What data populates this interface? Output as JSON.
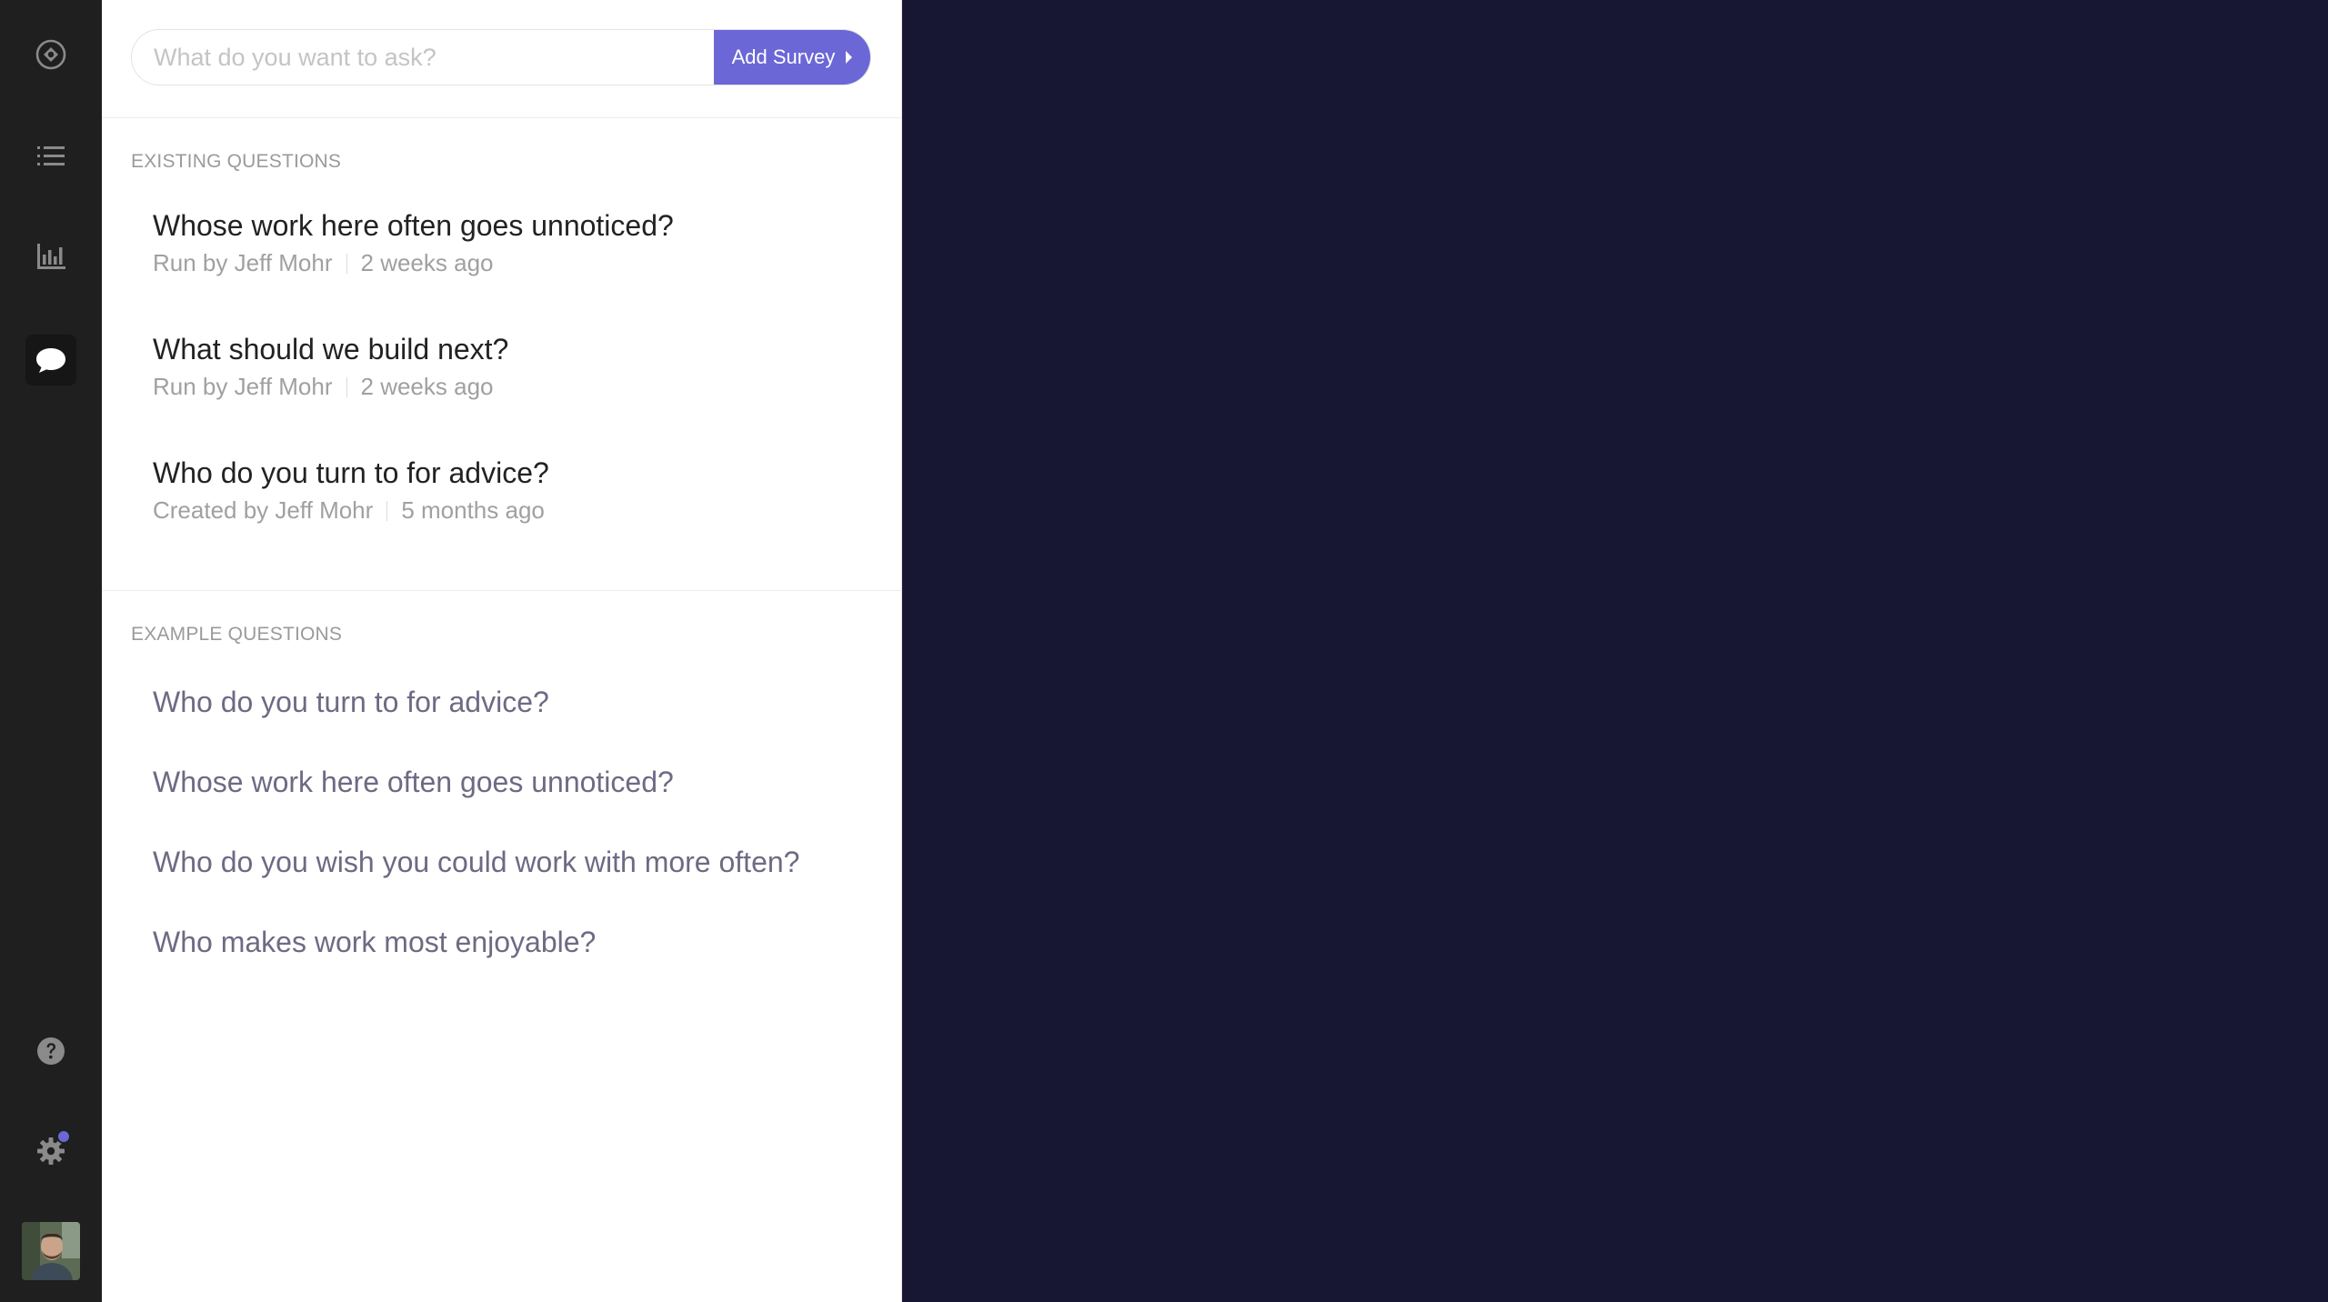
{
  "rail": {
    "items": [
      {
        "icon": "compass-icon"
      },
      {
        "icon": "numbered-list-icon"
      },
      {
        "icon": "bar-chart-icon"
      },
      {
        "icon": "chat-bubble-icon",
        "active": true
      },
      {
        "icon": "help-icon"
      },
      {
        "icon": "gear-icon",
        "badge": true
      }
    ],
    "accent": "#6b67d6"
  },
  "ask": {
    "placeholder": "What do you want to ask?",
    "button_label": "Add Survey"
  },
  "existing": {
    "label": "EXISTING QUESTIONS",
    "items": [
      {
        "title": "Whose work here often goes unnoticed?",
        "by": "Run by Jeff Mohr",
        "when": "2 weeks ago"
      },
      {
        "title": "What should we build next?",
        "by": "Run by Jeff Mohr",
        "when": "2 weeks ago"
      },
      {
        "title": "Who do you turn to for advice?",
        "by": "Created by Jeff Mohr",
        "when": "5 months ago"
      }
    ]
  },
  "examples": {
    "label": "EXAMPLE QUESTIONS",
    "items": [
      "Who do you turn to for advice?",
      "Whose work here often goes unnoticed?",
      "Who do you wish you could work with more often?",
      "Who makes work most enjoyable?"
    ]
  },
  "colors": {
    "rail_bg": "#1f1f1f",
    "page_bg": "#171733",
    "button": "#6b67d6"
  }
}
